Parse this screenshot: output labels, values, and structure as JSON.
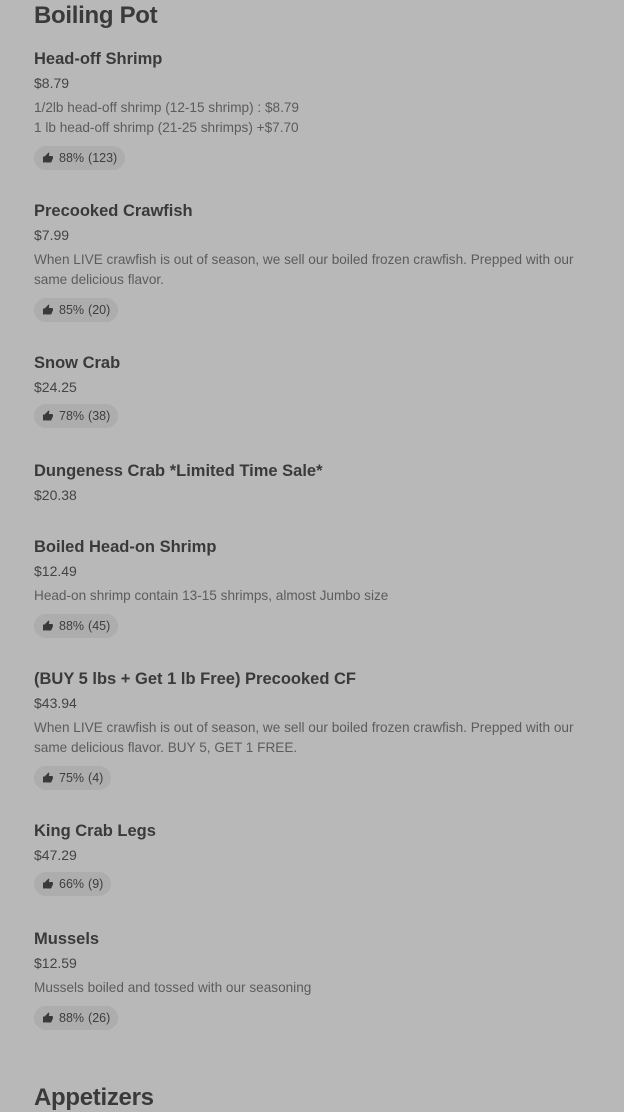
{
  "section": {
    "title": "Boiling Pot"
  },
  "next_section": {
    "title": "Appetizers"
  },
  "items": [
    {
      "name": "Head-off Shrimp",
      "price": "$8.79",
      "desc_lines": [
        "1/2lb head-off shrimp (12-15 shrimp) : $8.79",
        "1 lb head-off shrimp (21-25 shrimps) +$7.70"
      ],
      "rating": {
        "percent": "88%",
        "count": "(123)"
      }
    },
    {
      "name": "Precooked Crawfish",
      "price": "$7.99",
      "desc_lines": [
        "When LIVE crawfish is out of season, we sell our boiled frozen crawfish. Prepped with our same delicious flavor."
      ],
      "rating": {
        "percent": "85%",
        "count": "(20)"
      }
    },
    {
      "name": "Snow Crab",
      "price": "$24.25",
      "rating": {
        "percent": "78%",
        "count": "(38)"
      }
    },
    {
      "name": "Dungeness Crab *Limited Time Sale*",
      "price": "$20.38"
    },
    {
      "name": "Boiled Head-on Shrimp",
      "price": "$12.49",
      "desc_lines": [
        "Head-on shrimp contain 13-15 shrimps, almost Jumbo size"
      ],
      "rating": {
        "percent": "88%",
        "count": "(45)"
      }
    },
    {
      "name": "(BUY 5 lbs + Get 1 lb Free) Precooked CF",
      "price": "$43.94",
      "desc_lines": [
        "When LIVE crawfish is out of season, we sell our boiled frozen crawfish. Prepped with our same delicious flavor. BUY 5, GET 1 FREE."
      ],
      "rating": {
        "percent": "75%",
        "count": "(4)"
      }
    },
    {
      "name": "King Crab Legs",
      "price": "$47.29",
      "rating": {
        "percent": "66%",
        "count": "(9)"
      }
    },
    {
      "name": "Mussels",
      "price": "$12.59",
      "desc_lines": [
        "Mussels boiled and tossed with our seasoning"
      ],
      "rating": {
        "percent": "88%",
        "count": "(26)"
      }
    }
  ]
}
